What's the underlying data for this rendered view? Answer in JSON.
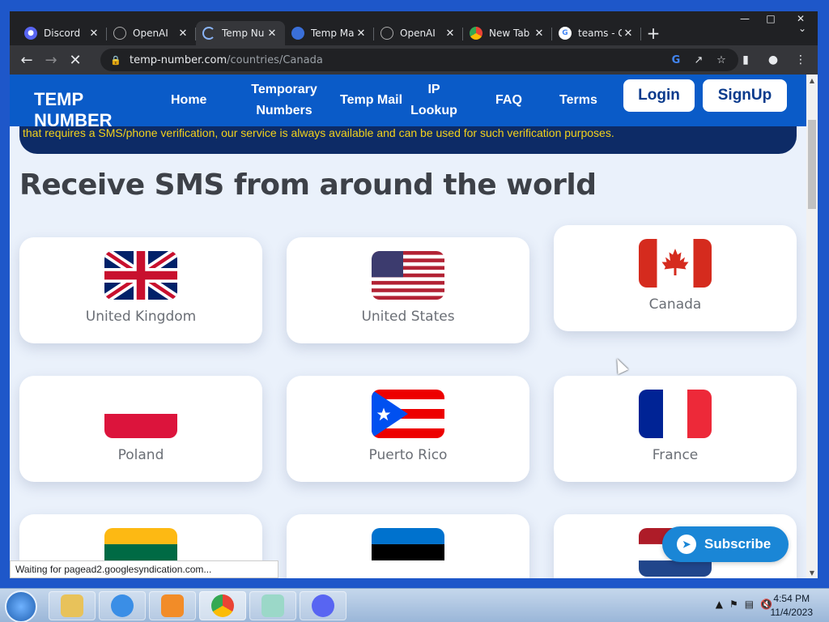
{
  "browser": {
    "tabs": [
      {
        "title": "Discord",
        "icon": "discord-icon",
        "color": "#5865f2",
        "active": false
      },
      {
        "title": "OpenAI",
        "icon": "openai-icon",
        "color": "#202124",
        "active": false
      },
      {
        "title": "Temp Nu",
        "icon": "loading-spinner-icon",
        "color": "#8ab4f8",
        "active": true
      },
      {
        "title": "Temp Ma",
        "icon": "temp-mail-icon",
        "color": "#3a6fd8",
        "active": false
      },
      {
        "title": "OpenAI",
        "icon": "openai-icon",
        "color": "#202124",
        "active": false
      },
      {
        "title": "New Tab",
        "icon": "chrome-icon",
        "color": "#e8eaed",
        "active": false
      },
      {
        "title": "teams - G",
        "icon": "google-icon",
        "color": "#ffffff",
        "active": false
      }
    ],
    "url_host": "temp-number.com",
    "url_path": "/countries/Canada",
    "status_text": "Waiting for pagead2.googlesyndication.com..."
  },
  "site": {
    "logo": "TEMP NUMBER",
    "nav": {
      "home": "Home",
      "temporary_numbers": "Temporary Numbers",
      "temp_mail": "Temp Mail",
      "ip_lookup": "IP Lookup",
      "faq": "FAQ",
      "terms": "Terms"
    },
    "login": "Login",
    "signup": "SignUp",
    "notice": "that requires a SMS/phone verification, our service is always available and can be used for such verification purposes.",
    "heading": "Receive SMS from around the world",
    "subscribe": "Subscribe"
  },
  "countries": [
    {
      "name": "United Kingdom",
      "flag": "uk-flag-icon"
    },
    {
      "name": "United States",
      "flag": "us-flag-icon"
    },
    {
      "name": "Canada",
      "flag": "canada-flag-icon"
    },
    {
      "name": "Poland",
      "flag": "poland-flag-icon"
    },
    {
      "name": "Puerto Rico",
      "flag": "puerto-rico-flag-icon"
    },
    {
      "name": "France",
      "flag": "france-flag-icon"
    },
    {
      "name": "",
      "flag": "lithuania-flag-icon"
    },
    {
      "name": "",
      "flag": "estonia-flag-icon"
    },
    {
      "name": "",
      "flag": "netherlands-flag-icon"
    }
  ],
  "taskbar": {
    "time": "4:54 PM",
    "date": "11/4/2023"
  }
}
